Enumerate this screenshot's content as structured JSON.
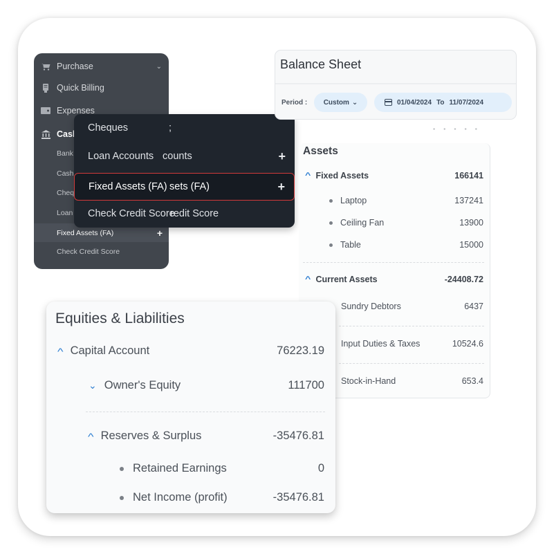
{
  "sidebar": {
    "items": [
      {
        "label": "Purchase",
        "icon": "cart-icon",
        "chevron": "⌄"
      },
      {
        "label": "Quick Billing",
        "icon": "receipt-icon"
      },
      {
        "label": "Expenses",
        "icon": "wallet-icon"
      },
      {
        "label": "Cash",
        "icon": "bank-icon"
      }
    ],
    "subitems": [
      "Bank",
      "Cash",
      "Cheq",
      "Loan"
    ],
    "active_subitem": {
      "label": "Fixed Assets (FA)",
      "plus": "+"
    },
    "last_subitem": "Check Credit Score"
  },
  "dropdown_menu": {
    "items": [
      {
        "label": "Cheques",
        "ghost": ";"
      },
      {
        "label": "Loan Accounts",
        "ghost": "counts",
        "plus": "+"
      },
      {
        "label": "Fixed Assets (FA)",
        "ghost": "sets (FA)",
        "plus": "+",
        "selected": true
      },
      {
        "label": "Check Credit Score",
        "ghost": "redit Score"
      }
    ],
    "highlight_color": "#d23a3a"
  },
  "balance_sheet": {
    "title": "Balance Sheet",
    "period_label": "Period :",
    "period_value": "Custom",
    "period_chevron": "⌄",
    "date_from": "01/04/2024",
    "date_sep": "To",
    "date_to": "11/07/2024"
  },
  "assets": {
    "title": "Assets",
    "fixed": {
      "label": "Fixed Assets",
      "value": "166141",
      "items": [
        {
          "label": "Laptop",
          "value": "137241"
        },
        {
          "label": "Ceiling Fan",
          "value": "13900"
        },
        {
          "label": "Table",
          "value": "15000"
        }
      ]
    },
    "current": {
      "label": "Current Assets",
      "value": "-24408.72",
      "items": [
        {
          "label": "Sundry Debtors",
          "value": "6437"
        },
        {
          "label": "Input Duties & Taxes",
          "value": "10524.6"
        },
        {
          "label": "Stock-in-Hand",
          "value": "653.4"
        }
      ]
    }
  },
  "equities": {
    "title": "Equities & Liabilities",
    "capital": {
      "label": "Capital Account",
      "value": "76223.19"
    },
    "owners_equity": {
      "label": "Owner's Equity",
      "value": "111700"
    },
    "reserves": {
      "label": "Reserves & Surplus",
      "value": "-35476.81",
      "items": [
        {
          "label": "Retained Earnings",
          "value": "0"
        },
        {
          "label": "Net Income (profit)",
          "value": "-35476.81"
        }
      ]
    }
  },
  "icons": {
    "caret_up": "^",
    "caret_down": "⌄"
  },
  "colors": {
    "accent": "#2f7fd1",
    "sidebar_bg": "#41464d",
    "menu_bg": "#1f252d",
    "pill_bg": "#e2effb"
  }
}
